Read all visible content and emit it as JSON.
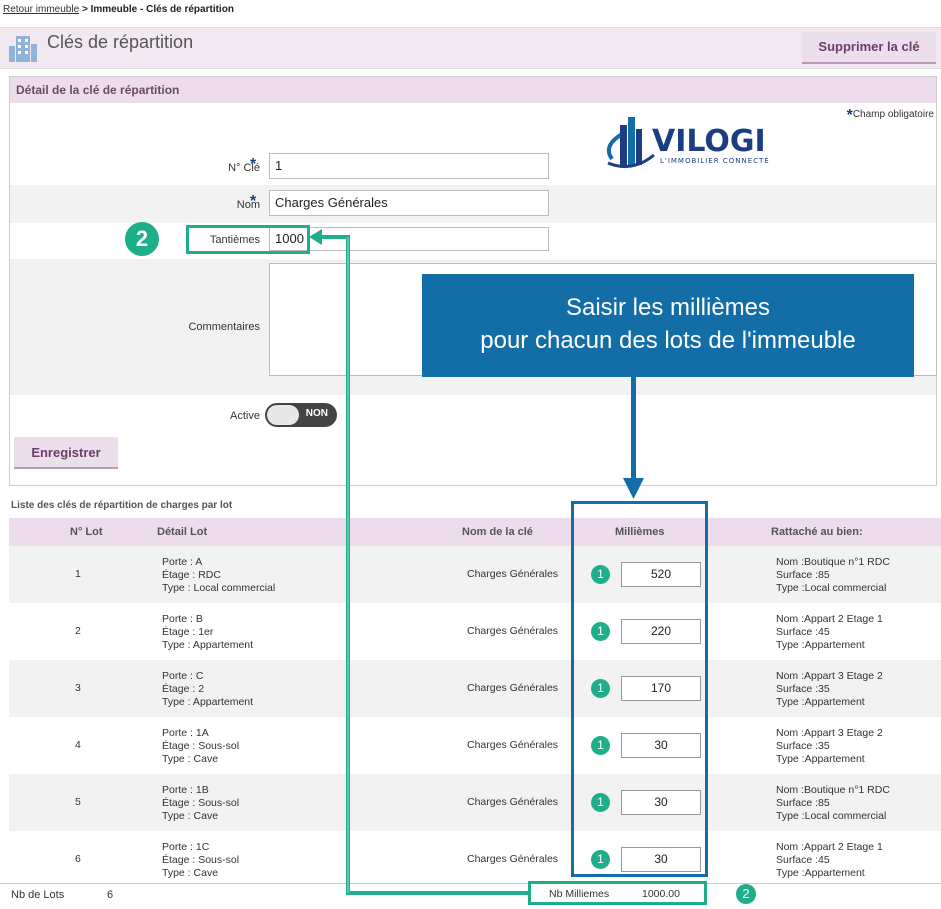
{
  "breadcrumb": {
    "back_link": "Retour immeuble",
    "separator": ">",
    "current": "Immeuble - Clés de répartition"
  },
  "header": {
    "title": "Clés de répartition",
    "delete_button": "Supprimer la clé"
  },
  "detail": {
    "section_title": "Détail de la clé de répartition",
    "required_note": "Champ obligatoire",
    "required_star": "*",
    "fields": {
      "cle_no": {
        "label": "N° Clé",
        "value": "1"
      },
      "nom": {
        "label": "Nom",
        "value": "Charges Générales"
      },
      "tantiemes": {
        "label": "Tantièmes",
        "value": "1000"
      },
      "commentaires": {
        "label": "Commentaires",
        "value": ""
      },
      "active": {
        "label": "Active",
        "toggle_text": "NON"
      }
    },
    "save_button": "Enregistrer"
  },
  "logo": {
    "name": "VILOGI",
    "tagline": "L'IMMOBILIER CONNECTÉ"
  },
  "list": {
    "title": "Liste des clés de répartition de charges par lot",
    "headers": {
      "lot_no": "N° Lot",
      "detail_lot": "Détail Lot",
      "key_name": "Nom de la clé",
      "milliemes": "Millièmes",
      "rattache": "Rattaché au bien:"
    },
    "rows": [
      {
        "lot": "1",
        "porte": "Porte : A",
        "etage": "Étage : RDC",
        "type": "Type : Local commercial",
        "key": "Charges Générales",
        "milliemes": "520",
        "bien_nom": "Nom :Boutique n°1 RDC",
        "bien_surface": "Surface :85",
        "bien_type": "Type :Local commercial"
      },
      {
        "lot": "2",
        "porte": "Porte : B",
        "etage": "Étage : 1er",
        "type": "Type : Appartement",
        "key": "Charges Générales",
        "milliemes": "220",
        "bien_nom": "Nom :Appart 2 Etage 1",
        "bien_surface": "Surface :45",
        "bien_type": "Type :Appartement"
      },
      {
        "lot": "3",
        "porte": "Porte : C",
        "etage": "Étage : 2",
        "type": "Type : Appartement",
        "key": "Charges Générales",
        "milliemes": "170",
        "bien_nom": "Nom :Appart 3 Etage 2",
        "bien_surface": "Surface :35",
        "bien_type": "Type :Appartement"
      },
      {
        "lot": "4",
        "porte": "Porte : 1A",
        "etage": "Étage : Sous-sol",
        "type": "Type : Cave",
        "key": "Charges Générales",
        "milliemes": "30",
        "bien_nom": "Nom :Appart 3 Etage 2",
        "bien_surface": "Surface :35",
        "bien_type": "Type :Appartement"
      },
      {
        "lot": "5",
        "porte": "Porte : 1B",
        "etage": "Étage : Sous-sol",
        "type": "Type : Cave",
        "key": "Charges Générales",
        "milliemes": "30",
        "bien_nom": "Nom :Boutique n°1 RDC",
        "bien_surface": "Surface :85",
        "bien_type": "Type :Local commercial"
      },
      {
        "lot": "6",
        "porte": "Porte : 1C",
        "etage": "Étage : Sous-sol",
        "type": "Type : Cave",
        "key": "Charges Générales",
        "milliemes": "30",
        "bien_nom": "Nom :Appart 2 Etage 1",
        "bien_surface": "Surface :45",
        "bien_type": "Type :Appartement"
      }
    ],
    "footer": {
      "nb_lots_label": "Nb de Lots",
      "nb_lots_value": "6",
      "nb_milliemes_label": "Nb Milliemes",
      "nb_milliemes_value": "1000.00"
    }
  },
  "annotations": {
    "callout_line1": "Saisir les millièmes",
    "callout_line2": "pour chacun des lots de l'immeuble",
    "badge_one": "1",
    "badge_two": "2",
    "accent_color": "#1fae8a",
    "callout_color": "#136ea8"
  }
}
